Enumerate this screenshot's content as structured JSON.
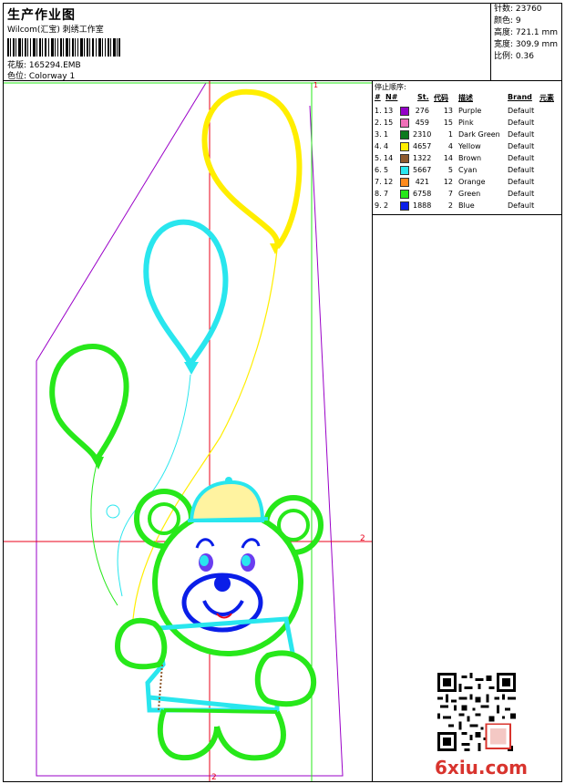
{
  "header": {
    "title": "生产作业图",
    "studio": "Wilcom(汇宝) 刺绣工作室",
    "design_label": "花版: 165294.EMB",
    "colorway_label": "色位: Colorway 1"
  },
  "stats": {
    "stitches": "针数: 23760",
    "colors": "颜色: 9",
    "height": "高度: 721.1 mm",
    "width": "宽度: 309.9 mm",
    "scale": "比例: 0.36"
  },
  "legend": {
    "title": "停止顺序:",
    "columns": {
      "num": "#",
      "needle": "N#",
      "st": "St.",
      "code": "代码",
      "desc": "描述",
      "brand": "Brand",
      "element": "元素"
    },
    "rows": [
      {
        "idx": "1.",
        "needle": "13",
        "color": "#9400c8",
        "st": "276",
        "code": "13",
        "desc": "Purple",
        "brand": "Default"
      },
      {
        "idx": "2.",
        "needle": "15",
        "color": "#f06fb8",
        "st": "459",
        "code": "15",
        "desc": "Pink",
        "brand": "Default"
      },
      {
        "idx": "3.",
        "needle": "1",
        "color": "#0d7a1d",
        "st": "2310",
        "code": "1",
        "desc": "Dark Green",
        "brand": "Default"
      },
      {
        "idx": "4.",
        "needle": "4",
        "color": "#ffee00",
        "st": "4657",
        "code": "4",
        "desc": "Yellow",
        "brand": "Default"
      },
      {
        "idx": "5.",
        "needle": "14",
        "color": "#8e5a2e",
        "st": "1322",
        "code": "14",
        "desc": "Brown",
        "brand": "Default"
      },
      {
        "idx": "6.",
        "needle": "5",
        "color": "#29e6ee",
        "st": "5667",
        "code": "5",
        "desc": "Cyan",
        "brand": "Default"
      },
      {
        "idx": "7.",
        "needle": "12",
        "color": "#ff8a1e",
        "st": "421",
        "code": "12",
        "desc": "Orange",
        "brand": "Default"
      },
      {
        "idx": "8.",
        "needle": "7",
        "color": "#27e81a",
        "st": "6758",
        "code": "7",
        "desc": "Green",
        "brand": "Default"
      },
      {
        "idx": "9.",
        "needle": "2",
        "color": "#0a1ee8",
        "st": "1888",
        "code": "2",
        "desc": "Blue",
        "brand": "Default"
      }
    ]
  },
  "markers": {
    "top": "1",
    "right": "2",
    "bottom": "2"
  },
  "watermark": {
    "brand": "6xiu.com"
  }
}
